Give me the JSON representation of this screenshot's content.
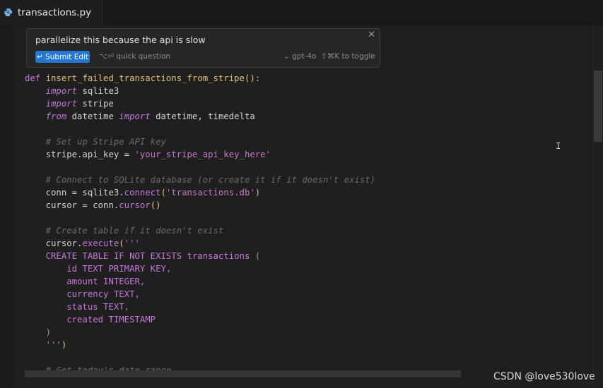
{
  "tab": {
    "filename": "transactions.py",
    "icon": "python-file-icon"
  },
  "inline_edit": {
    "prompt": "parallelize this because the api is slow",
    "submit_label": "↵ Submit Edit",
    "quick_question": "⌥⏎ quick question",
    "model": "⌄ gpt-4o",
    "toggle_hint": "⇧⌘K to toggle",
    "close": "✕"
  },
  "code_lines": [
    [
      [
        "kw",
        "def "
      ],
      [
        "fn",
        "insert_failed_transactions_from_stripe"
      ],
      [
        "paren",
        "():"
      ]
    ],
    [
      [
        "plain",
        "    "
      ],
      [
        "kw-i",
        "import"
      ],
      [
        "plain",
        " sqlite3"
      ]
    ],
    [
      [
        "plain",
        "    "
      ],
      [
        "kw-i",
        "import"
      ],
      [
        "plain",
        " stripe"
      ]
    ],
    [
      [
        "plain",
        "    "
      ],
      [
        "kw-i",
        "from"
      ],
      [
        "plain",
        " datetime "
      ],
      [
        "kw-i",
        "import"
      ],
      [
        "plain",
        " datetime, timedelta"
      ]
    ],
    [
      [
        "plain",
        ""
      ]
    ],
    [
      [
        "cmt",
        "    # Set up Stripe API key"
      ]
    ],
    [
      [
        "plain",
        "    stripe.api_key = "
      ],
      [
        "str",
        "'your_stripe_api_key_here'"
      ]
    ],
    [
      [
        "plain",
        ""
      ]
    ],
    [
      [
        "cmt",
        "    # Connect to SQLite database (or create it if it doesn't exist)"
      ]
    ],
    [
      [
        "plain",
        "    conn = sqlite3."
      ],
      [
        "meth",
        "connect"
      ],
      [
        "paren",
        "("
      ],
      [
        "str",
        "'transactions.db'"
      ],
      [
        "paren",
        ")"
      ]
    ],
    [
      [
        "plain",
        "    cursor = conn."
      ],
      [
        "meth",
        "cursor"
      ],
      [
        "paren",
        "()"
      ]
    ],
    [
      [
        "plain",
        ""
      ]
    ],
    [
      [
        "cmt",
        "    # Create table if it doesn't exist"
      ]
    ],
    [
      [
        "plain",
        "    cursor."
      ],
      [
        "meth",
        "execute"
      ],
      [
        "paren",
        "("
      ],
      [
        "strq",
        "'''"
      ]
    ],
    [
      [
        "sql",
        "    CREATE TABLE IF NOT EXISTS transactions ("
      ]
    ],
    [
      [
        "sql",
        "        id TEXT PRIMARY KEY,"
      ]
    ],
    [
      [
        "sql",
        "        amount INTEGER,"
      ]
    ],
    [
      [
        "sql",
        "        currency TEXT,"
      ]
    ],
    [
      [
        "sql",
        "        status TEXT,"
      ]
    ],
    [
      [
        "sql",
        "        created TIMESTAMP"
      ]
    ],
    [
      [
        "sql",
        "    )"
      ]
    ],
    [
      [
        "plain",
        "    "
      ],
      [
        "strq",
        "'''"
      ],
      [
        "paren",
        ")"
      ]
    ],
    [
      [
        "plain",
        ""
      ]
    ],
    [
      [
        "cmt",
        "    # Get today's date range"
      ]
    ]
  ],
  "watermark": "CSDN @love530love",
  "colors": {
    "background": "#1f1f1f",
    "accent": "#2378d4",
    "keyword": "#c678dd",
    "function": "#e5c07b",
    "comment": "#6a6a6a"
  }
}
